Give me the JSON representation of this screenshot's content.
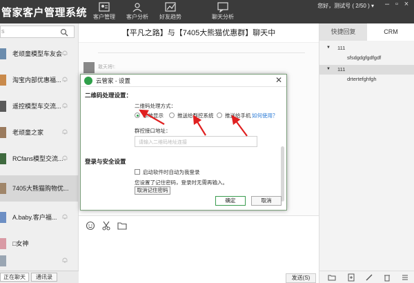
{
  "app": {
    "title": "管家客户管理系统",
    "user_info": "您好，测试号 ( 2/50 ) ▾"
  },
  "nav": [
    {
      "label": "客户管理",
      "icon": "contacts-card-icon"
    },
    {
      "label": "客户分析",
      "icon": "person-analysis-icon"
    },
    {
      "label": "好友趋势",
      "icon": "trend-chart-icon"
    },
    {
      "label": "聊天分析",
      "icon": "chat-analysis-icon"
    }
  ],
  "sidebar": {
    "search_lead": "s",
    "items": [
      {
        "name": "老顽童模型车友会"
      },
      {
        "name": "淘宝内部优惠福..."
      },
      {
        "name": "遥控模型车交流..."
      },
      {
        "name": "老顽童之家"
      },
      {
        "name": "RCfans模型交流..."
      },
      {
        "name": "7405大熊猫购物优..."
      },
      {
        "name": "A.baby.客户福..."
      },
      {
        "name": "□女神"
      },
      {
        "name": ""
      }
    ],
    "tabs": {
      "chatting": "正在聊天",
      "contacts": "通讯录"
    }
  },
  "chat": {
    "title": "【平凡之路】与【7405大熊猫优惠群】聊天中",
    "msg_sender": "敢天将!:",
    "send_label": "发送(S)"
  },
  "right_panel": {
    "tabs": {
      "quick_reply": "快捷回复",
      "crm": "CRM"
    },
    "tree": [
      {
        "label": "111",
        "level": 0,
        "selected": false
      },
      {
        "label": "sfsdgdgfgdfgdf",
        "level": 1,
        "selected": false
      },
      {
        "label": "111",
        "level": 0,
        "selected": true
      },
      {
        "label": "drtertefghfgh",
        "level": 1,
        "selected": false
      }
    ]
  },
  "dialog": {
    "title": "云管家 - 设置",
    "close": "✕",
    "qr_section": "二维码处理设置：",
    "qr_method_label": "二维码处理方式：",
    "options": [
      {
        "label": "本地显示",
        "checked": true
      },
      {
        "label": "推送给群控系统",
        "checked": false
      },
      {
        "label": "推送给手机",
        "checked": false
      }
    ],
    "help_link": "如何使用？",
    "group_addr_label": "群控接口地址：",
    "group_addr_placeholder": "请输入二维码地址连接",
    "login_section": "登录与安全设置",
    "autostart_label": "启动软件时自动为我登录",
    "remember_text": "您设置了记住密码，登录时无需再输入。",
    "cancel_remember": "取消记住密码",
    "ok": "确定",
    "cancel": "取消"
  },
  "colors": {
    "topbar": "#3b3b3b",
    "accent_green": "#2fa04a",
    "link": "#2b7bd6",
    "annotation_red": "#e02020"
  }
}
